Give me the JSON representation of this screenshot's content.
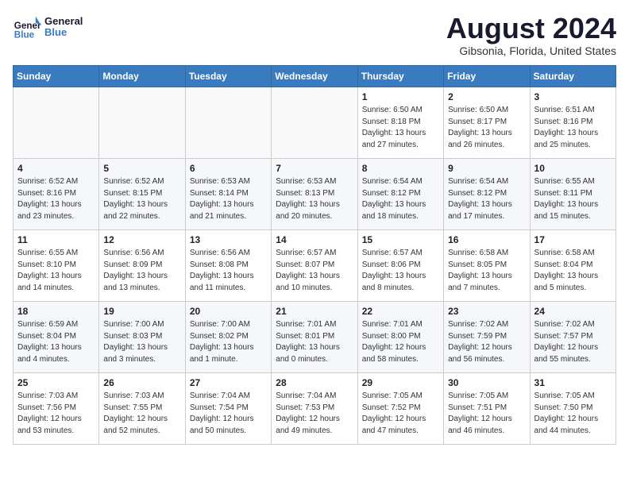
{
  "header": {
    "logo_line1": "General",
    "logo_line2": "Blue",
    "main_title": "August 2024",
    "subtitle": "Gibsonia, Florida, United States"
  },
  "weekdays": [
    "Sunday",
    "Monday",
    "Tuesday",
    "Wednesday",
    "Thursday",
    "Friday",
    "Saturday"
  ],
  "weeks": [
    [
      {
        "day": "",
        "info": ""
      },
      {
        "day": "",
        "info": ""
      },
      {
        "day": "",
        "info": ""
      },
      {
        "day": "",
        "info": ""
      },
      {
        "day": "1",
        "info": "Sunrise: 6:50 AM\nSunset: 8:18 PM\nDaylight: 13 hours\nand 27 minutes."
      },
      {
        "day": "2",
        "info": "Sunrise: 6:50 AM\nSunset: 8:17 PM\nDaylight: 13 hours\nand 26 minutes."
      },
      {
        "day": "3",
        "info": "Sunrise: 6:51 AM\nSunset: 8:16 PM\nDaylight: 13 hours\nand 25 minutes."
      }
    ],
    [
      {
        "day": "4",
        "info": "Sunrise: 6:52 AM\nSunset: 8:16 PM\nDaylight: 13 hours\nand 23 minutes."
      },
      {
        "day": "5",
        "info": "Sunrise: 6:52 AM\nSunset: 8:15 PM\nDaylight: 13 hours\nand 22 minutes."
      },
      {
        "day": "6",
        "info": "Sunrise: 6:53 AM\nSunset: 8:14 PM\nDaylight: 13 hours\nand 21 minutes."
      },
      {
        "day": "7",
        "info": "Sunrise: 6:53 AM\nSunset: 8:13 PM\nDaylight: 13 hours\nand 20 minutes."
      },
      {
        "day": "8",
        "info": "Sunrise: 6:54 AM\nSunset: 8:12 PM\nDaylight: 13 hours\nand 18 minutes."
      },
      {
        "day": "9",
        "info": "Sunrise: 6:54 AM\nSunset: 8:12 PM\nDaylight: 13 hours\nand 17 minutes."
      },
      {
        "day": "10",
        "info": "Sunrise: 6:55 AM\nSunset: 8:11 PM\nDaylight: 13 hours\nand 15 minutes."
      }
    ],
    [
      {
        "day": "11",
        "info": "Sunrise: 6:55 AM\nSunset: 8:10 PM\nDaylight: 13 hours\nand 14 minutes."
      },
      {
        "day": "12",
        "info": "Sunrise: 6:56 AM\nSunset: 8:09 PM\nDaylight: 13 hours\nand 13 minutes."
      },
      {
        "day": "13",
        "info": "Sunrise: 6:56 AM\nSunset: 8:08 PM\nDaylight: 13 hours\nand 11 minutes."
      },
      {
        "day": "14",
        "info": "Sunrise: 6:57 AM\nSunset: 8:07 PM\nDaylight: 13 hours\nand 10 minutes."
      },
      {
        "day": "15",
        "info": "Sunrise: 6:57 AM\nSunset: 8:06 PM\nDaylight: 13 hours\nand 8 minutes."
      },
      {
        "day": "16",
        "info": "Sunrise: 6:58 AM\nSunset: 8:05 PM\nDaylight: 13 hours\nand 7 minutes."
      },
      {
        "day": "17",
        "info": "Sunrise: 6:58 AM\nSunset: 8:04 PM\nDaylight: 13 hours\nand 5 minutes."
      }
    ],
    [
      {
        "day": "18",
        "info": "Sunrise: 6:59 AM\nSunset: 8:04 PM\nDaylight: 13 hours\nand 4 minutes."
      },
      {
        "day": "19",
        "info": "Sunrise: 7:00 AM\nSunset: 8:03 PM\nDaylight: 13 hours\nand 3 minutes."
      },
      {
        "day": "20",
        "info": "Sunrise: 7:00 AM\nSunset: 8:02 PM\nDaylight: 13 hours\nand 1 minute."
      },
      {
        "day": "21",
        "info": "Sunrise: 7:01 AM\nSunset: 8:01 PM\nDaylight: 13 hours\nand 0 minutes."
      },
      {
        "day": "22",
        "info": "Sunrise: 7:01 AM\nSunset: 8:00 PM\nDaylight: 12 hours\nand 58 minutes."
      },
      {
        "day": "23",
        "info": "Sunrise: 7:02 AM\nSunset: 7:59 PM\nDaylight: 12 hours\nand 56 minutes."
      },
      {
        "day": "24",
        "info": "Sunrise: 7:02 AM\nSunset: 7:57 PM\nDaylight: 12 hours\nand 55 minutes."
      }
    ],
    [
      {
        "day": "25",
        "info": "Sunrise: 7:03 AM\nSunset: 7:56 PM\nDaylight: 12 hours\nand 53 minutes."
      },
      {
        "day": "26",
        "info": "Sunrise: 7:03 AM\nSunset: 7:55 PM\nDaylight: 12 hours\nand 52 minutes."
      },
      {
        "day": "27",
        "info": "Sunrise: 7:04 AM\nSunset: 7:54 PM\nDaylight: 12 hours\nand 50 minutes."
      },
      {
        "day": "28",
        "info": "Sunrise: 7:04 AM\nSunset: 7:53 PM\nDaylight: 12 hours\nand 49 minutes."
      },
      {
        "day": "29",
        "info": "Sunrise: 7:05 AM\nSunset: 7:52 PM\nDaylight: 12 hours\nand 47 minutes."
      },
      {
        "day": "30",
        "info": "Sunrise: 7:05 AM\nSunset: 7:51 PM\nDaylight: 12 hours\nand 46 minutes."
      },
      {
        "day": "31",
        "info": "Sunrise: 7:05 AM\nSunset: 7:50 PM\nDaylight: 12 hours\nand 44 minutes."
      }
    ]
  ]
}
